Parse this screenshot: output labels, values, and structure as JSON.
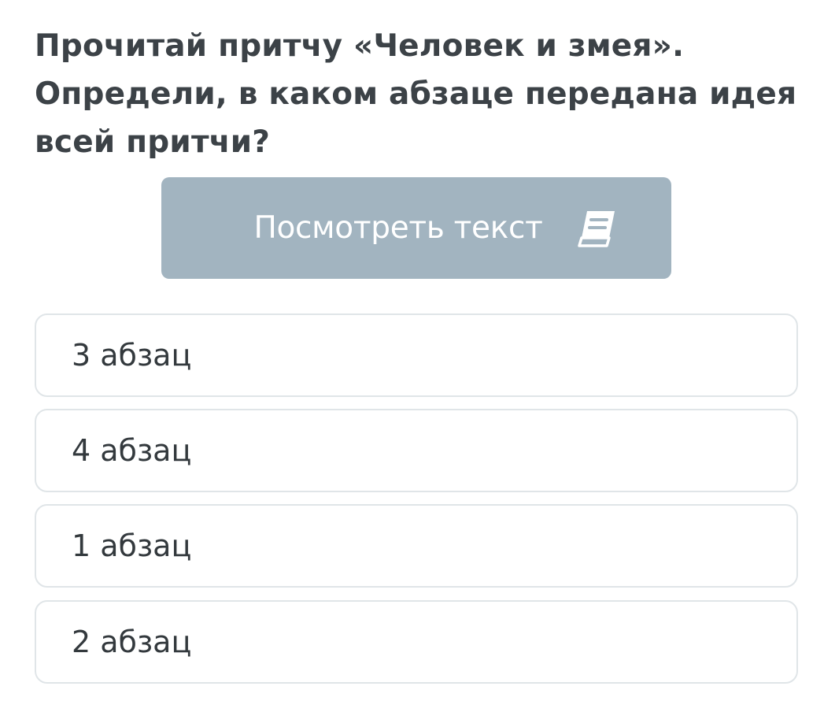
{
  "question": {
    "text": "Прочитай притчу «Человек и змея». Определи, в каком абзаце передана идея всей притчи?"
  },
  "view_text_button": {
    "label": "Посмотреть текст",
    "icon": "book-icon"
  },
  "options": [
    {
      "label": "3 абзац"
    },
    {
      "label": "4 абзац"
    },
    {
      "label": "1 абзац"
    },
    {
      "label": "2 абзац"
    }
  ],
  "colors": {
    "question_text": "#3c4247",
    "button_bg": "#a2b4c0",
    "button_text": "#ffffff",
    "option_border": "#e0e5e8",
    "option_text": "#33393d"
  }
}
